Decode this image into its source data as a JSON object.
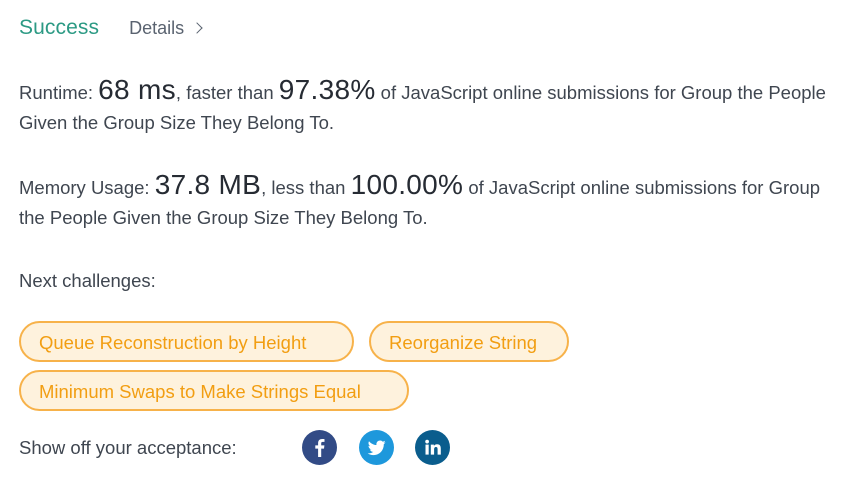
{
  "header": {
    "status": "Success",
    "details_label": "Details",
    "status_color": "#2c9a84"
  },
  "runtime": {
    "label": "Runtime: ",
    "value": "68 ms",
    "comparison": ", faster than ",
    "percent": "97.38%",
    "suffix": " of JavaScript online submissions for Group the People Given the Group Size They Belong To."
  },
  "memory": {
    "label": "Memory Usage: ",
    "value": "37.8 MB",
    "comparison": ", less than ",
    "percent": "100.00%",
    "suffix": " of JavaScript online submissions for Group the People Given the Group Size They Belong To."
  },
  "next": {
    "label": "Next challenges:",
    "challenges": [
      "Queue Reconstruction by Height",
      "Reorganize String",
      "Minimum Swaps to Make Strings Equal"
    ],
    "chip_color": "#f29e12"
  },
  "share": {
    "label": "Show off your acceptance:",
    "icons": [
      "facebook-icon",
      "twitter-icon",
      "linkedin-icon"
    ],
    "colors": {
      "facebook": "#324b86",
      "twitter": "#1e98dc",
      "linkedin": "#0a5d8d"
    }
  }
}
